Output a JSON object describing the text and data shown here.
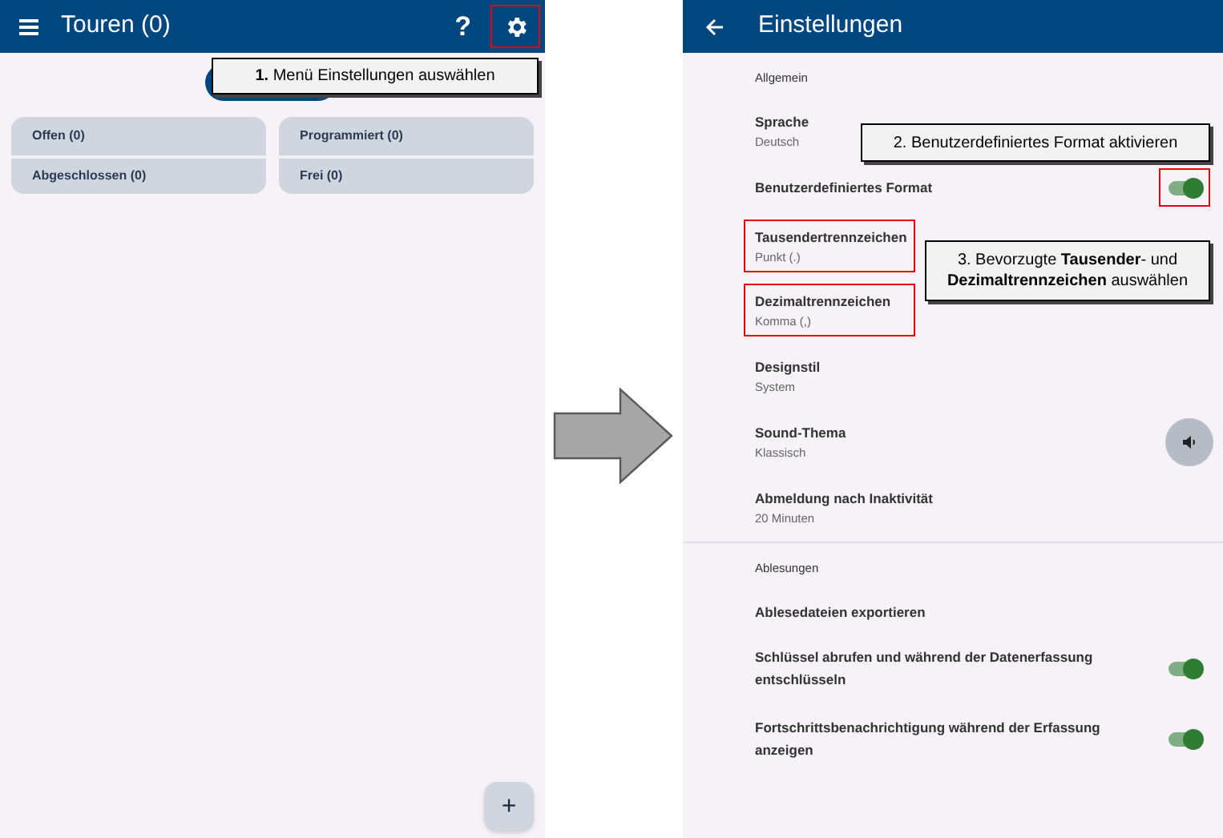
{
  "left_screen": {
    "title": "Touren (0)",
    "help_label": "?",
    "settings_highlighted": true,
    "cards": [
      {
        "items": [
          "Offen (0)",
          "Abgeschlossen (0)"
        ]
      },
      {
        "items": [
          "Programmiert (0)",
          "Frei (0)"
        ]
      }
    ],
    "add_label": "+"
  },
  "right_screen": {
    "title": "Einstellungen",
    "sections": [
      {
        "label": "Allgemein",
        "items": [
          {
            "kind": "text",
            "title": "Sprache",
            "value": "Deutsch",
            "highlighted": false
          },
          {
            "kind": "toggle",
            "title": "Benutzerdefiniertes Format",
            "on": true,
            "highlighted": true
          },
          {
            "kind": "text",
            "title": "Tausendertrennzeichen",
            "value": "Punkt (.)",
            "highlighted": true
          },
          {
            "kind": "text",
            "title": "Dezimaltrennzeichen",
            "value": "Komma (,)",
            "highlighted": true
          },
          {
            "kind": "text",
            "title": "Designstil",
            "value": "System",
            "highlighted": false
          },
          {
            "kind": "sound",
            "title": "Sound-Thema",
            "value": "Klassisch",
            "highlighted": false
          },
          {
            "kind": "text",
            "title": "Abmeldung nach Inaktivität",
            "value": "20 Minuten",
            "highlighted": false
          }
        ]
      },
      {
        "label": "Ablesungen",
        "items": [
          {
            "kind": "text",
            "title": "Ablesedateien exportieren",
            "highlighted": false
          },
          {
            "kind": "toggle",
            "title": "Schlüssel abrufen und während der Datenerfassung entschlüsseln",
            "on": true,
            "highlighted": false
          },
          {
            "kind": "toggle",
            "title": "Fortschrittsbenachrichtigung während der Erfassung anzeigen",
            "on": true,
            "highlighted": false
          }
        ]
      }
    ]
  },
  "callouts": [
    "**1.** Menü Einstellungen auswählen",
    "2. Benutzerdefiniertes Format aktivieren",
    "3. Bevorzugte **Tausender**- und **Dezimaltrennzeichen** auswählen"
  ]
}
